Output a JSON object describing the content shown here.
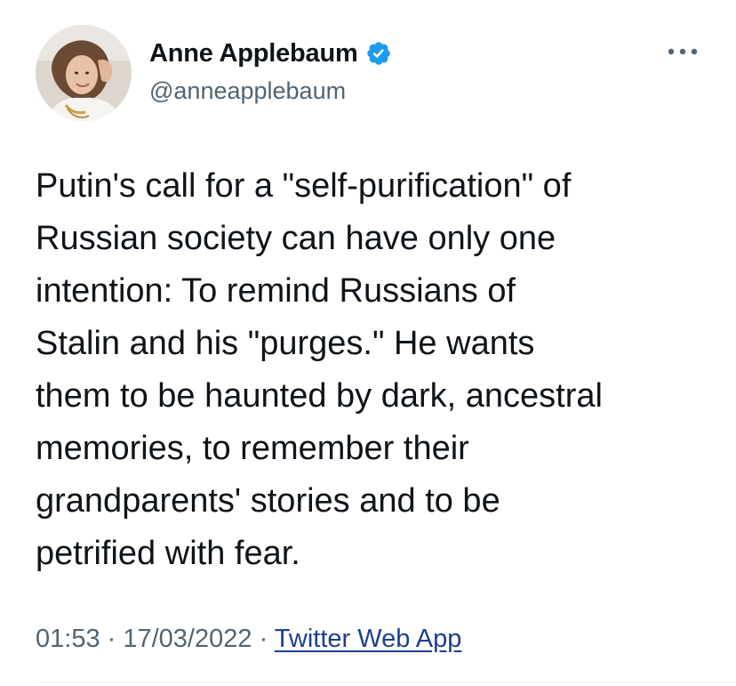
{
  "author": {
    "display_name": "Anne Applebaum",
    "handle": "@anneapplebaum",
    "verified": true,
    "avatar_icon": "profile-photo"
  },
  "tweet": {
    "text": "Putin's call for a \"self-purification\" of\nRussian society can have only one\nintention: To remind Russians of\nStalin and his \"purges.\" He wants\nthem to be haunted by dark, ancestral\nmemories, to remember their\ngrandparents' stories and to be\npetrified with fear."
  },
  "meta": {
    "time": "01:53",
    "separator": " · ",
    "date": "17/03/2022",
    "source": "Twitter Web App"
  },
  "icons": {
    "verified": "verified-badge-icon",
    "more": "more-options-icon"
  },
  "colors": {
    "verified_blue": "#1d9bf0",
    "secondary_text": "#536471",
    "link": "#1d3f8f"
  }
}
